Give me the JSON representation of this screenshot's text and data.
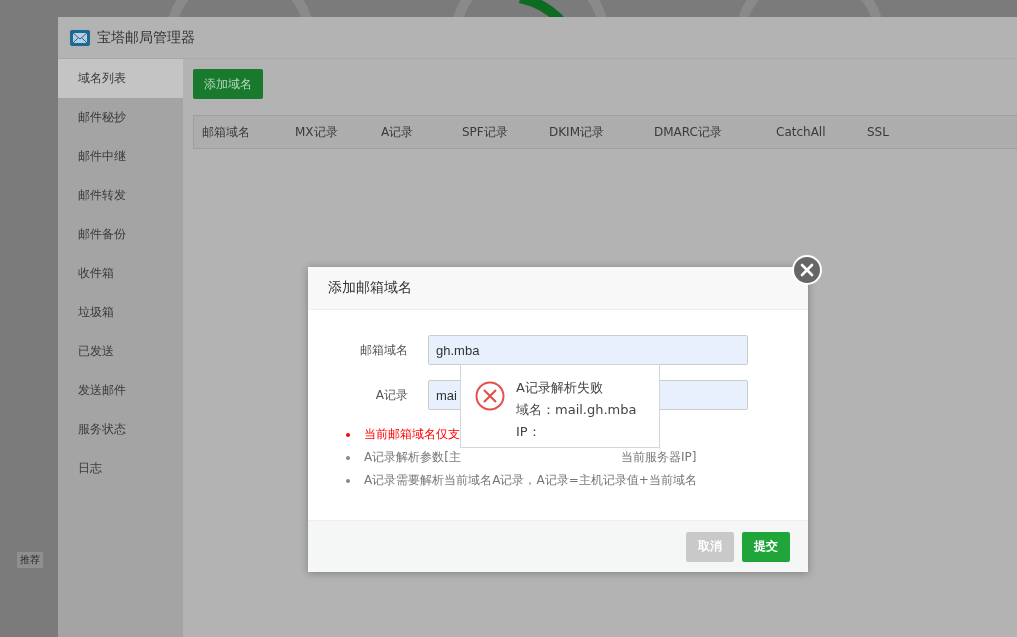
{
  "window": {
    "title": "宝塔邮局管理器"
  },
  "sidebar": {
    "items": [
      {
        "label": "域名列表",
        "selected": true
      },
      {
        "label": "邮件秘抄",
        "selected": false
      },
      {
        "label": "邮件中继",
        "selected": false
      },
      {
        "label": "邮件转发",
        "selected": false
      },
      {
        "label": "邮件备份",
        "selected": false
      },
      {
        "label": "收件箱",
        "selected": false
      },
      {
        "label": "垃圾箱",
        "selected": false
      },
      {
        "label": "已发送",
        "selected": false
      },
      {
        "label": "发送邮件",
        "selected": false
      },
      {
        "label": "服务状态",
        "selected": false
      },
      {
        "label": "日志",
        "selected": false
      }
    ]
  },
  "toolbar": {
    "add_button": "添加域名"
  },
  "table": {
    "columns": [
      "邮箱域名",
      "MX记录",
      "A记录",
      "SPF记录",
      "DKIM记录",
      "DMARC记录",
      "CatchAll",
      "SSL"
    ]
  },
  "background": {
    "tag": "推荐"
  },
  "dialog": {
    "title": "添加邮箱域名",
    "fields": [
      {
        "label": "邮箱域名",
        "value": "gh.mba"
      },
      {
        "label": "A记录",
        "value": "mai"
      }
    ],
    "notes": [
      {
        "kind": "warning",
        "parts": [
          "当前邮箱域名仅支"
        ]
      },
      {
        "kind": "info",
        "parts": [
          "A记录解析参数[主",
          "当前服务器IP]"
        ]
      },
      {
        "kind": "info",
        "parts": [
          "A记录需要解析当前域名A记录，A记录=主机记录值+当前域名"
        ]
      }
    ],
    "buttons": [
      {
        "label": "取消",
        "disabled": true
      },
      {
        "label": "提交",
        "disabled": false
      }
    ]
  },
  "tooltip": {
    "title": "A记录解析失败",
    "lines": [
      "域名：mail.gh.mba",
      "IP："
    ]
  }
}
